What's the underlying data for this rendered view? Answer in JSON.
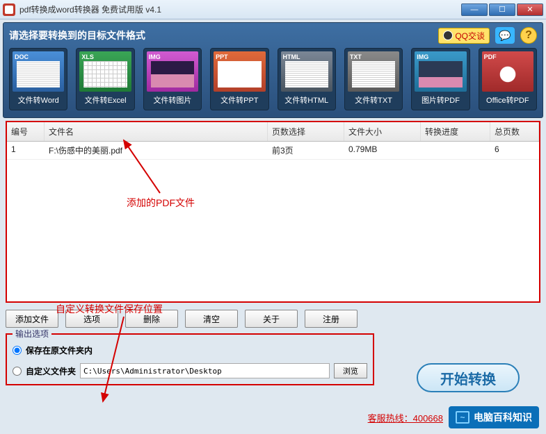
{
  "window": {
    "title": "pdf转换成word转换器 免费试用版 v4.1"
  },
  "header": {
    "title": "请选择要转换到的目标文件格式",
    "qq_label": "QQ交谈"
  },
  "formats": [
    {
      "tag": "DOC",
      "label": "文件转Word",
      "cls": "th-doc"
    },
    {
      "tag": "XLS",
      "label": "文件转Excel",
      "cls": "th-xls"
    },
    {
      "tag": "IMG",
      "label": "文件转图片",
      "cls": "th-img"
    },
    {
      "tag": "PPT",
      "label": "文件转PPT",
      "cls": "th-ppt"
    },
    {
      "tag": "HTML",
      "label": "文件转HTML",
      "cls": "th-html"
    },
    {
      "tag": "TXT",
      "label": "文件转TXT",
      "cls": "th-txt"
    },
    {
      "tag": "IMG",
      "label": "图片转PDF",
      "cls": "th-imgpdf"
    },
    {
      "tag": "PDF",
      "label": "Office转PDF",
      "cls": "th-pdf"
    }
  ],
  "grid": {
    "columns": {
      "num": "编号",
      "name": "文件名",
      "sel": "页数选择",
      "size": "文件大小",
      "prog": "转换进度",
      "total": "总页数"
    },
    "rows": [
      {
        "num": "1",
        "name": "F:\\伤感中的美丽.pdf",
        "sel": "前3页",
        "size": "0.79MB",
        "prog": "",
        "total": "6"
      }
    ]
  },
  "annotations": {
    "added_file": "添加的PDF文件",
    "custom_path": "自定义转换文件保存位置"
  },
  "buttons": {
    "add": "添加文件",
    "options": "选项",
    "delete": "删除",
    "clear": "清空",
    "about": "关于",
    "register": "注册"
  },
  "output": {
    "legend": "输出选项",
    "same_folder": "保存在原文件夹内",
    "custom_folder": "自定义文件夹",
    "path": "C:\\Users\\Administrator\\Desktop",
    "browse": "浏览"
  },
  "start_label": "开始转换",
  "footer": {
    "hotline": "客服热线：400668",
    "watermark": "电脑百科知识"
  }
}
